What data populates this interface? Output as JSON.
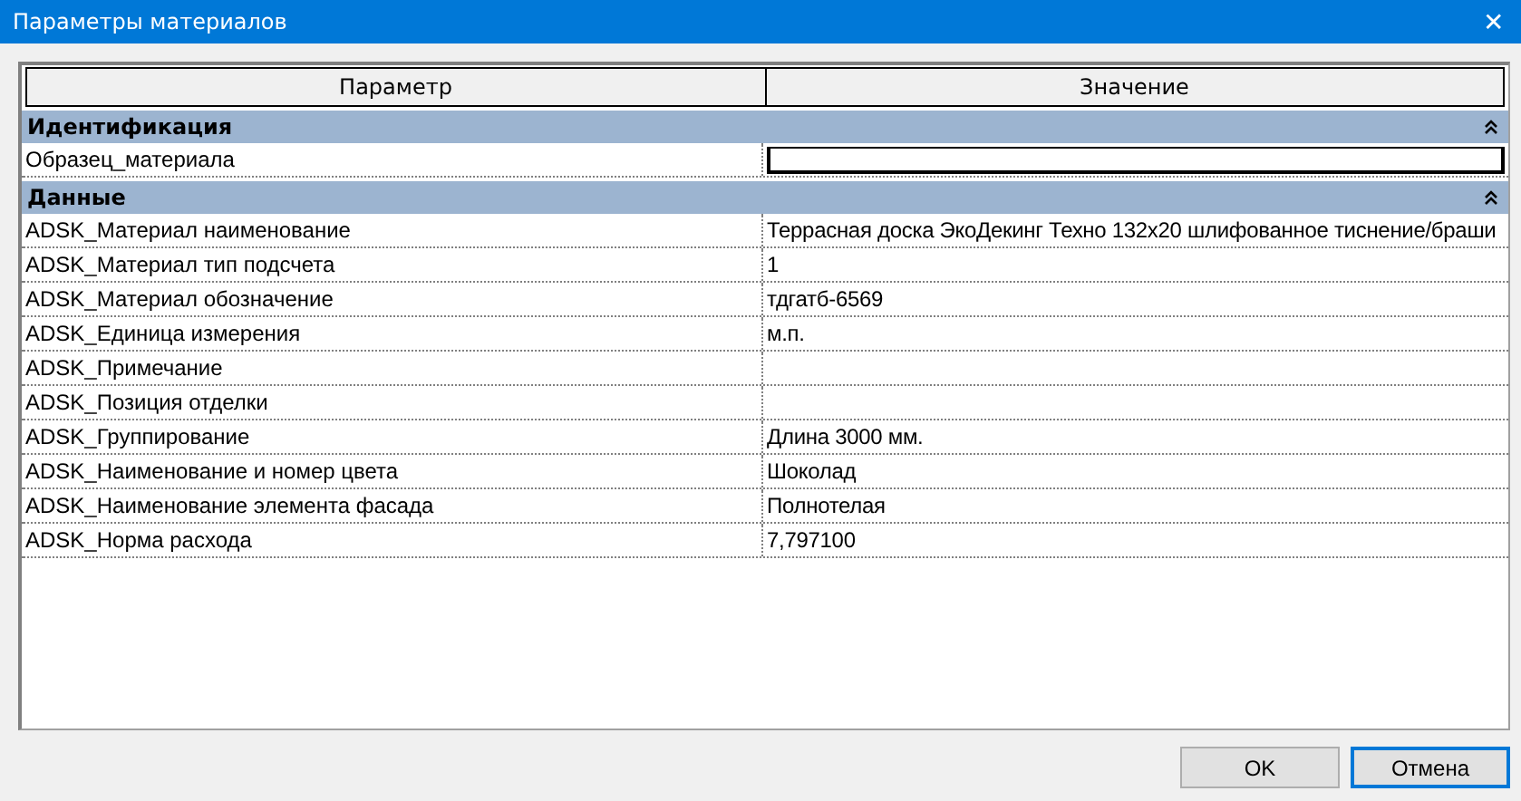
{
  "window": {
    "title": "Параметры материалов",
    "close": "✕"
  },
  "table": {
    "columns": [
      "Параметр",
      "Значение"
    ],
    "groups": [
      {
        "title": "Идентификация",
        "expanded": true,
        "rows": [
          {
            "name": "Образец_материала",
            "value": "",
            "kind": "field"
          }
        ]
      },
      {
        "title": "Данные",
        "expanded": true,
        "rows": [
          {
            "name": "ADSK_Материал наименование",
            "value": "Террасная доска ЭкоДекинг Техно 132х20 шлифованное тиснение/браши",
            "kind": "text"
          },
          {
            "name": "ADSK_Материал тип подсчета",
            "value": "1",
            "kind": "text"
          },
          {
            "name": "ADSK_Материал обозначение",
            "value": "тдгатб-6569",
            "kind": "text"
          },
          {
            "name": "ADSK_Единица измерения",
            "value": "м.п.",
            "kind": "text"
          },
          {
            "name": "ADSK_Примечание",
            "value": "",
            "kind": "text"
          },
          {
            "name": "ADSK_Позиция отделки",
            "value": "",
            "kind": "text"
          },
          {
            "name": "ADSK_Группирование",
            "value": "Длина 3000 мм.",
            "kind": "text"
          },
          {
            "name": "ADSK_Наименование и номер цвета",
            "value": "Шоколад",
            "kind": "text"
          },
          {
            "name": "ADSK_Наименование элемента фасада",
            "value": "Полнотелая",
            "kind": "text"
          },
          {
            "name": "ADSK_Норма расхода",
            "value": "7,797100",
            "kind": "text"
          }
        ]
      }
    ]
  },
  "buttons": [
    {
      "label": "OK",
      "focused": false
    },
    {
      "label": "Отмена",
      "focused": true
    }
  ]
}
